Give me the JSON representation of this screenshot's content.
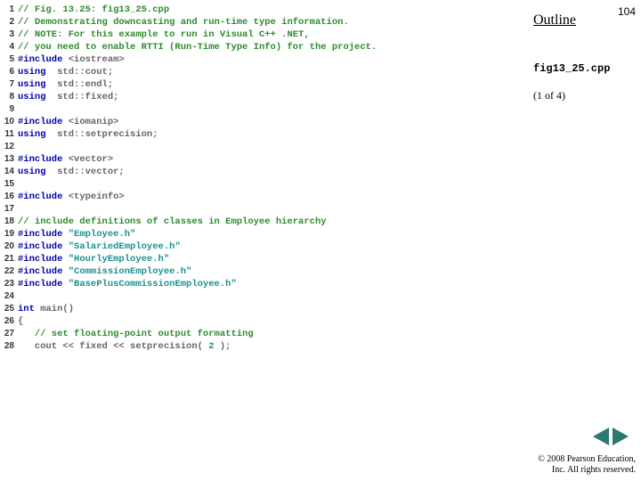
{
  "header": {
    "outline_label": "Outline",
    "page_number": "104",
    "filename": "fig13_25.cpp",
    "pager": "(1 of 4)",
    "copyright_line1": "© 2008 Pearson Education,",
    "copyright_line2": "Inc.  All rights reserved."
  },
  "code": {
    "lines": [
      {
        "n": 1,
        "t": [
          [
            "com",
            "// Fig. 13.25: fig13_25.cpp"
          ]
        ]
      },
      {
        "n": 2,
        "t": [
          [
            "com",
            "// Demonstrating downcasting and run-time type information."
          ]
        ]
      },
      {
        "n": 3,
        "t": [
          [
            "com",
            "// NOTE: For this example to run in Visual C++ .NET,"
          ]
        ]
      },
      {
        "n": 4,
        "t": [
          [
            "com",
            "// you need to enable RTTI (Run-Time Type Info) for the project."
          ]
        ]
      },
      {
        "n": 5,
        "t": [
          [
            "kw",
            "#include "
          ],
          [
            "pl",
            "<iostream>"
          ]
        ]
      },
      {
        "n": 6,
        "t": [
          [
            "kw",
            "using"
          ],
          [
            "pl",
            "  std::cout;"
          ]
        ]
      },
      {
        "n": 7,
        "t": [
          [
            "kw",
            "using"
          ],
          [
            "pl",
            "  std::endl;"
          ]
        ]
      },
      {
        "n": 8,
        "t": [
          [
            "kw",
            "using"
          ],
          [
            "pl",
            "  std::fixed;"
          ]
        ]
      },
      {
        "n": 9,
        "t": []
      },
      {
        "n": 10,
        "t": [
          [
            "kw",
            "#include "
          ],
          [
            "pl",
            "<iomanip>"
          ]
        ]
      },
      {
        "n": 11,
        "t": [
          [
            "kw",
            "using"
          ],
          [
            "pl",
            "  std::setprecision;"
          ]
        ]
      },
      {
        "n": 12,
        "t": []
      },
      {
        "n": 13,
        "t": [
          [
            "kw",
            "#include "
          ],
          [
            "pl",
            "<vector>"
          ]
        ]
      },
      {
        "n": 14,
        "t": [
          [
            "kw",
            "using"
          ],
          [
            "pl",
            "  std::vector;"
          ]
        ]
      },
      {
        "n": 15,
        "t": []
      },
      {
        "n": 16,
        "t": [
          [
            "kw",
            "#include "
          ],
          [
            "pl",
            "<typeinfo>"
          ]
        ]
      },
      {
        "n": 17,
        "t": []
      },
      {
        "n": 18,
        "t": [
          [
            "com",
            "// include definitions of classes in Employee hierarchy"
          ]
        ]
      },
      {
        "n": 19,
        "t": [
          [
            "kw",
            "#include "
          ],
          [
            "str",
            "\"Employee.h\""
          ]
        ]
      },
      {
        "n": 20,
        "t": [
          [
            "kw",
            "#include "
          ],
          [
            "str",
            "\"SalariedEmployee.h\""
          ]
        ]
      },
      {
        "n": 21,
        "t": [
          [
            "kw",
            "#include "
          ],
          [
            "str",
            "\"HourlyEmployee.h\""
          ]
        ]
      },
      {
        "n": 22,
        "t": [
          [
            "kw",
            "#include "
          ],
          [
            "str",
            "\"CommissionEmployee.h\""
          ]
        ]
      },
      {
        "n": 23,
        "t": [
          [
            "kw",
            "#include "
          ],
          [
            "str",
            "\"BasePlusCommissionEmployee.h\""
          ]
        ]
      },
      {
        "n": 24,
        "t": []
      },
      {
        "n": 25,
        "t": [
          [
            "kw",
            "int"
          ],
          [
            "pl",
            " main()"
          ]
        ]
      },
      {
        "n": 26,
        "t": [
          [
            "pl",
            "{"
          ]
        ]
      },
      {
        "n": 27,
        "t": [
          [
            "pl",
            "   "
          ],
          [
            "com",
            "// set floating-point output formatting"
          ]
        ]
      },
      {
        "n": 28,
        "t": [
          [
            "pl",
            "   cout << fixed << setprecision( "
          ],
          [
            "num",
            "2"
          ],
          [
            "pl",
            " );"
          ]
        ]
      }
    ]
  }
}
